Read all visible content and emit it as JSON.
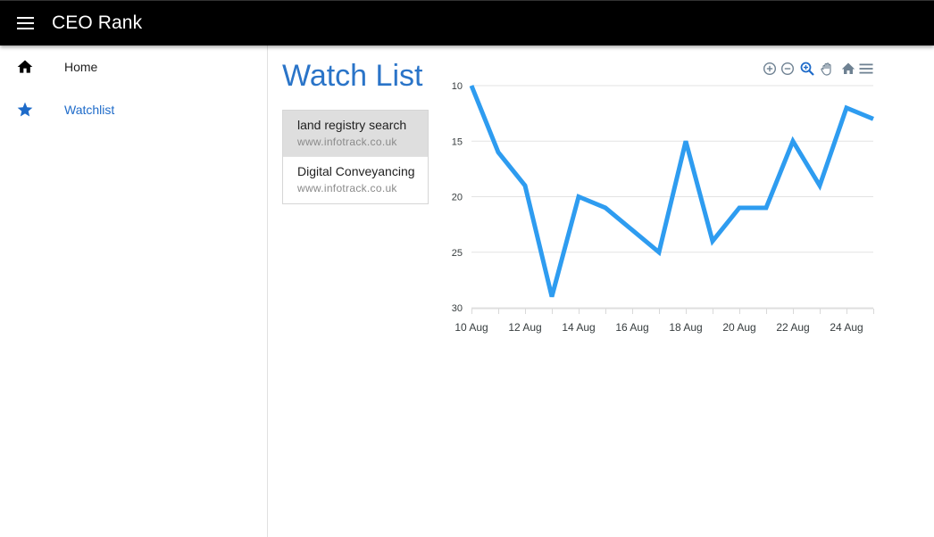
{
  "appbar": {
    "title": "CEO Rank",
    "menu_icon": "menu-icon"
  },
  "sidebar": {
    "items": [
      {
        "label": "Home",
        "icon": "home-icon",
        "active": false
      },
      {
        "label": "Watchlist",
        "icon": "star-icon",
        "active": true
      }
    ]
  },
  "main": {
    "title": "Watch List",
    "watchlist": [
      {
        "title": "land registry search",
        "url": "www.infotrack.co.uk",
        "selected": true
      },
      {
        "title": "Digital Conveyancing",
        "url": "www.infotrack.co.uk",
        "selected": false
      }
    ]
  },
  "toolbar": {
    "icons": [
      "zoom-in-icon",
      "zoom-out-icon",
      "selection-zoom-icon",
      "pan-icon",
      "reset-home-icon",
      "chart-menu-icon"
    ]
  },
  "colors": {
    "appbar": "#000000",
    "accent": "#1e6bc9",
    "title": "#2a74c8",
    "line": "#2e9cf0",
    "toolbar_active": "#1e6bc9",
    "toolbar": "#6e8192"
  },
  "chart_data": {
    "type": "line",
    "x": [
      "10 Aug",
      "11 Aug",
      "12 Aug",
      "13 Aug",
      "14 Aug",
      "15 Aug",
      "16 Aug",
      "17 Aug",
      "18 Aug",
      "19 Aug",
      "20 Aug",
      "21 Aug",
      "22 Aug",
      "23 Aug",
      "24 Aug",
      "25 Aug"
    ],
    "tick_labels": [
      "10 Aug",
      "12 Aug",
      "14 Aug",
      "16 Aug",
      "18 Aug",
      "20 Aug",
      "22 Aug",
      "24 Aug"
    ],
    "series": [
      {
        "values": [
          10,
          16,
          19,
          29,
          20,
          21,
          23,
          25,
          15,
          24,
          21,
          21,
          15,
          19,
          12,
          13
        ]
      }
    ],
    "yticks": [
      10,
      15,
      20,
      25,
      30
    ],
    "ylim": [
      10,
      30
    ],
    "y_reversed": true,
    "grid": true
  }
}
